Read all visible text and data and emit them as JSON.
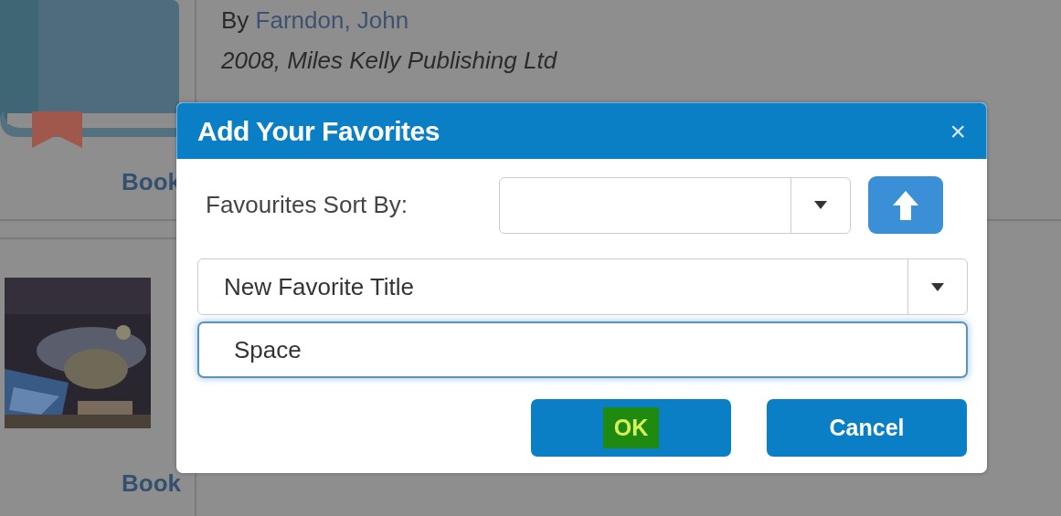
{
  "records": [
    {
      "format": "Book",
      "cover": {
        "kind": "icon"
      },
      "author_prefix": "By",
      "author": "Farndon, John",
      "publication": "2008, Miles Kelly Publishing Ltd"
    },
    {
      "format": "Book"
    }
  ],
  "dialog": {
    "title": "Add Your Favorites",
    "close": "×",
    "sort_label": "Favourites Sort By:",
    "favorite_select": {
      "value": "New Favorite Title"
    },
    "title_input": {
      "value": "Space",
      "focused": true
    },
    "buttons": [
      {
        "label": "OK",
        "highlighted": true
      },
      {
        "label": "Cancel",
        "highlighted": false
      }
    ]
  }
}
